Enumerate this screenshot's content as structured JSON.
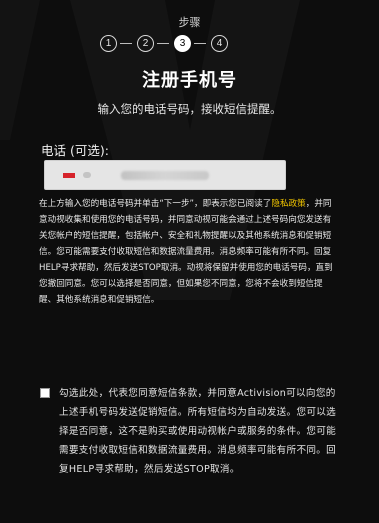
{
  "steps": {
    "title": "步骤",
    "items": [
      "1",
      "2",
      "3",
      "4"
    ],
    "active_index": 2
  },
  "form": {
    "heading": "注册手机号",
    "subtitle": "输入您的电话号码，接收短信提醒。",
    "phone_label": "电话 (可选):",
    "phone_value_visible": false
  },
  "notice": {
    "before_link": "在上方输入您的电话号码并单击“下一步”，即表示您已阅读了",
    "link": "隐私政策",
    "after_link": "，并同意动视收集和使用您的电话号码，并同意动视可能会通过上述号码向您发送有关您帐户的短信提醒，包括帐户、安全和礼物提醒以及其他系统消息和促销短信。您可能需要支付收取短信和数据流量费用。消息频率可能有所不同。回复HELP寻求帮助，然后发送STOP取消。动视将保留并使用您的电话号码，直到您撤回同意。您可以选择是否同意，但如果您不同意，您将不会收到短信提醒、其他系统消息和促销短信。"
  },
  "consent": {
    "checked": false,
    "text": "勾选此处，代表您同意短信条款，并同意Activision可以向您的上述手机号码发送促销短信。所有短信均为自动发送。您可以选择是否同意，这不是购买或使用动视帐户或服务的条件。您可能需要支付收取短信和数据流量费用。消息频率可能有所不同。回复HELP寻求帮助，然后发送STOP取消。"
  },
  "colors": {
    "background": "#0d0d0d",
    "link": "#f0c400",
    "flag": "#d6232b"
  }
}
